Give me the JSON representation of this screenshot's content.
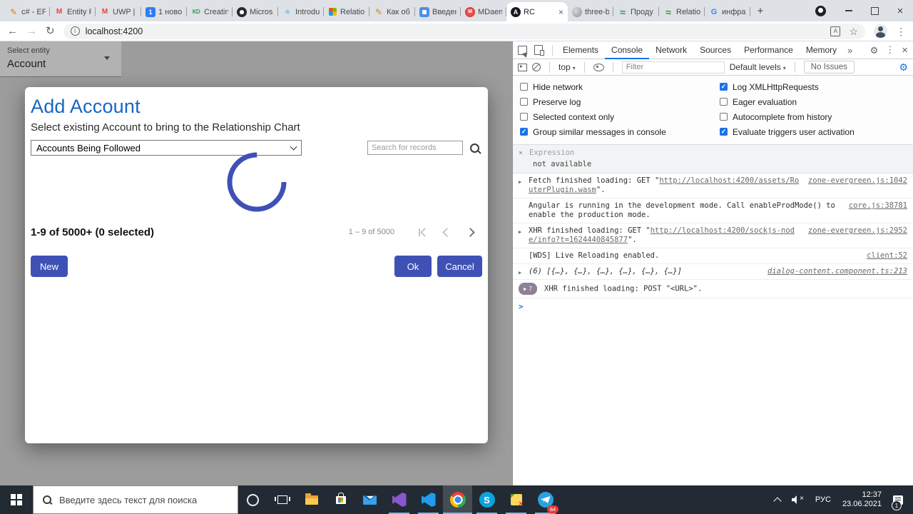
{
  "browser": {
    "tabs": [
      {
        "icon": "habr",
        "label": "c# - EF"
      },
      {
        "icon": "gmail",
        "label": "Entity F"
      },
      {
        "icon": "gmail",
        "label": "UWP | S"
      },
      {
        "icon": "counter",
        "label": "1 ново"
      },
      {
        "icon": "kd",
        "label": "Creatin"
      },
      {
        "icon": "github",
        "label": "Micros"
      },
      {
        "icon": "sparkle",
        "label": "Introdu"
      },
      {
        "icon": "microsoft",
        "label": "Relatio"
      },
      {
        "icon": "habr",
        "label": "Как об"
      },
      {
        "icon": "blueapp",
        "label": "Введен"
      },
      {
        "icon": "mdaemon",
        "label": "MDaem"
      },
      {
        "icon": "angular",
        "label": "RC",
        "active": true
      },
      {
        "icon": "globe",
        "label": "three-b"
      },
      {
        "icon": "waves",
        "label": "Проду"
      },
      {
        "icon": "waves",
        "label": "Relatio"
      },
      {
        "icon": "google",
        "label": "инфра"
      }
    ],
    "url": "localhost:4200"
  },
  "page": {
    "entity_select": {
      "label": "Select entity",
      "value": "Account"
    },
    "dialog": {
      "title": "Add Account",
      "subtitle": "Select existing Account to bring to the Relationship Chart",
      "view_select_value": "Accounts Being Followed",
      "search_placeholder": "Search for records",
      "selection_summary": "1-9 of 5000+ (0 selected)",
      "paginator_range": "1 – 9 of 5000",
      "buttons": {
        "new": "New",
        "ok": "Ok",
        "cancel": "Cancel"
      }
    }
  },
  "devtools": {
    "tabs": [
      {
        "label": "Elements"
      },
      {
        "label": "Console",
        "active": true
      },
      {
        "label": "Network"
      },
      {
        "label": "Sources"
      },
      {
        "label": "Performance"
      },
      {
        "label": "Memory"
      }
    ],
    "toolbar": {
      "context": "top",
      "filter_placeholder": "Filter",
      "levels": "Default levels",
      "no_issues": "No Issues"
    },
    "settings": [
      {
        "label": "Hide network",
        "checked": false
      },
      {
        "label": "Log XMLHttpRequests",
        "checked": true
      },
      {
        "label": "Preserve log",
        "checked": false
      },
      {
        "label": "Eager evaluation",
        "checked": false
      },
      {
        "label": "Selected context only",
        "checked": false
      },
      {
        "label": "Autocomplete from history",
        "checked": false
      },
      {
        "label": "Group similar messages in console",
        "checked": true
      },
      {
        "label": "Evaluate triggers user activation",
        "checked": true
      }
    ],
    "expression": {
      "label": "Expression",
      "value": "not available"
    },
    "messages": [
      {
        "expand": true,
        "segments": [
          {
            "t": "text",
            "v": "Fetch finished loading: GET \""
          },
          {
            "t": "link",
            "v": "http://localhost:4200/assets/RouterPlugin.wasm"
          },
          {
            "t": "text",
            "v": "\"."
          }
        ],
        "source": "zone-evergreen.js:1042"
      },
      {
        "segments": [
          {
            "t": "text",
            "v": "Angular is running in the development mode. Call enableProdMode() to enable the production mode."
          }
        ],
        "source": "core.js:38781"
      },
      {
        "expand": true,
        "segments": [
          {
            "t": "text",
            "v": "XHR finished loading: GET \""
          },
          {
            "t": "link",
            "v": "http://localhost:4200/sockjs-node/info?t=1624440845877"
          },
          {
            "t": "text",
            "v": "\"."
          }
        ],
        "source": "zone-evergreen.js:2952"
      },
      {
        "segments": [
          {
            "t": "text",
            "v": "[WDS] Live Reloading enabled."
          }
        ],
        "source": "client:52"
      },
      {
        "expand": true,
        "italic": true,
        "segments": [
          {
            "t": "text",
            "v": "(6) [{…}, {…}, {…}, {…}, {…}, {…}]"
          }
        ],
        "source": "dialog-content.component.ts:213"
      },
      {
        "badge": "7",
        "segments": [
          {
            "t": "text",
            "v": "XHR finished loading: POST \"<URL>\"."
          }
        ]
      }
    ],
    "prompt": ">"
  },
  "taskbar": {
    "search_placeholder": "Введите здесь текст для поиска",
    "apps": [
      {
        "icon": "cortana"
      },
      {
        "icon": "taskview"
      },
      {
        "icon": "explorer"
      },
      {
        "icon": "store"
      },
      {
        "icon": "mail"
      },
      {
        "icon": "vs",
        "running": true
      },
      {
        "icon": "vscode",
        "running": true
      },
      {
        "icon": "chrome",
        "running": true,
        "active": true
      },
      {
        "icon": "skype",
        "running": true
      },
      {
        "icon": "notes",
        "running": true
      },
      {
        "icon": "telegram",
        "running": true,
        "badge": "84"
      }
    ],
    "tray": {
      "language": "РУС",
      "time": "12:37",
      "date": "23.06.2021",
      "notification_badge": "1"
    }
  }
}
